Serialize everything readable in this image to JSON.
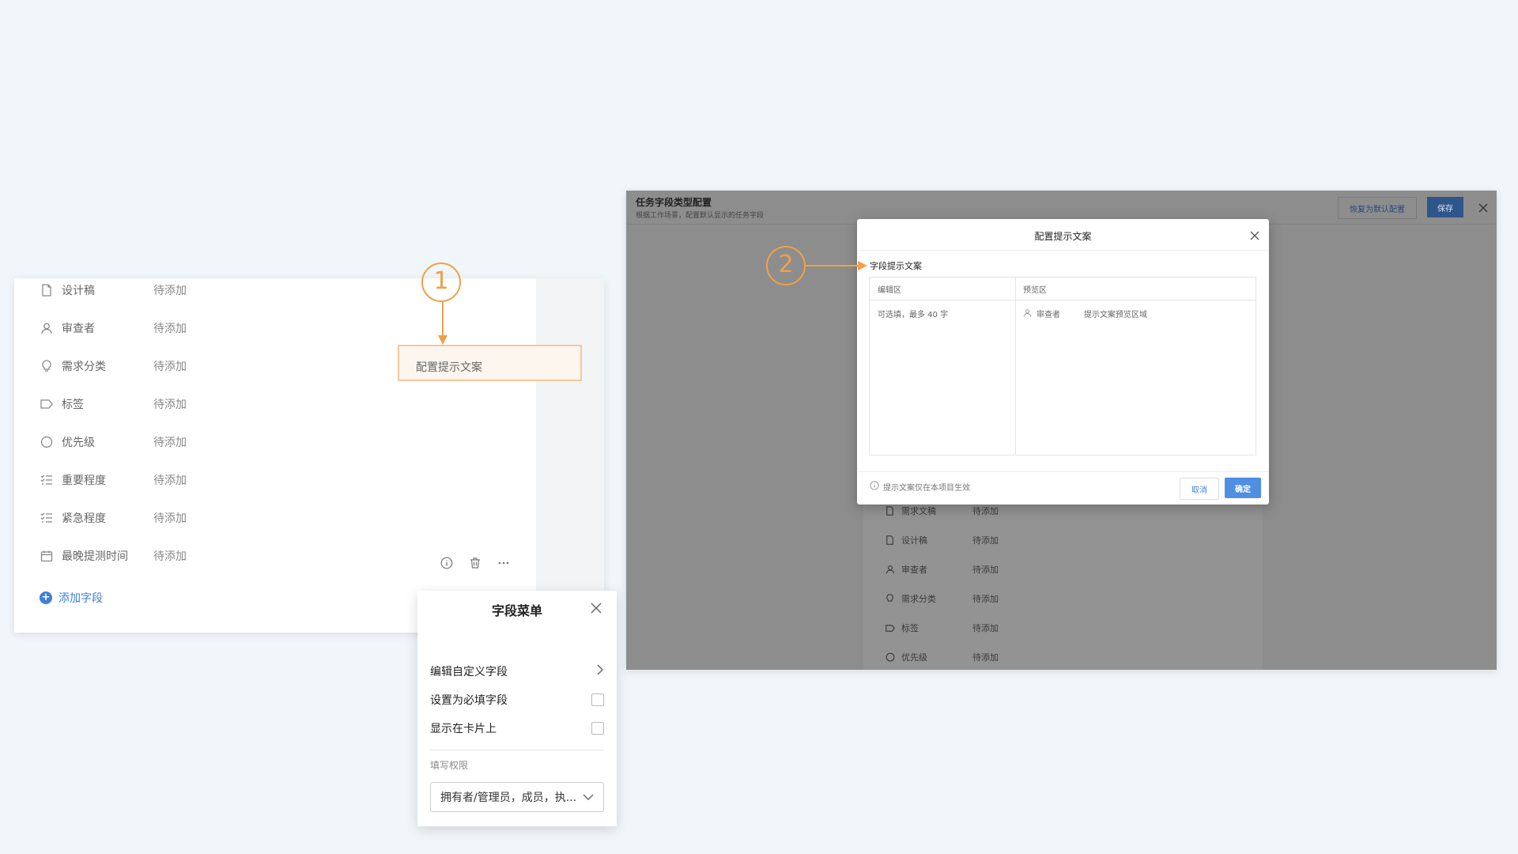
{
  "left": {
    "fields": [
      {
        "name": "设计稿",
        "status": "待添加",
        "icon": "file-icon"
      },
      {
        "name": "审查者",
        "status": "待添加",
        "icon": "user-icon"
      },
      {
        "name": "需求分类",
        "status": "待添加",
        "icon": "bulb-icon"
      },
      {
        "name": "标签",
        "status": "待添加",
        "icon": "tag-icon"
      },
      {
        "name": "优先级",
        "status": "待添加",
        "icon": "circle-icon"
      },
      {
        "name": "重要程度",
        "status": "待添加",
        "icon": "list-icon"
      },
      {
        "name": "紧急程度",
        "status": "待添加",
        "icon": "list-icon"
      },
      {
        "name": "最晚提测时间",
        "status": "待添加",
        "icon": "calendar-icon"
      }
    ],
    "add_field_label": "添加字段",
    "menu": {
      "title": "字段菜单",
      "config_hint": "配置提示文案",
      "edit_custom": "编辑自定义字段",
      "set_required": "设置为必填字段",
      "show_on_card": "显示在卡片上",
      "permission_label": "填写权限",
      "permission_value": "拥有者/管理员，成员，执..."
    }
  },
  "markers": {
    "one": "1",
    "two": "2"
  },
  "accent_color": "#f0a048",
  "right": {
    "title": "任务字段类型配置",
    "subtitle": "根据工作场景，配置默认显示的任务字段",
    "restore_label": "恢复为默认配置",
    "save_label": "保存",
    "background_rows": [
      {
        "name": "需求文稿",
        "status": "待添加",
        "icon": "file-icon"
      },
      {
        "name": "设计稿",
        "status": "待添加",
        "icon": "file-icon"
      },
      {
        "name": "审查者",
        "status": "待添加",
        "icon": "user-icon"
      },
      {
        "name": "需求分类",
        "status": "待添加",
        "icon": "bulb-icon"
      },
      {
        "name": "标签",
        "status": "待添加",
        "icon": "tag-icon"
      },
      {
        "name": "优先级",
        "status": "待添加",
        "icon": "circle-icon"
      }
    ],
    "dialog": {
      "title": "配置提示文案",
      "section_label": "字段提示文案",
      "col_edit": "编辑区",
      "col_preview": "预览区",
      "edit_placeholder": "可选填，最多 40 字",
      "preview_field": "审查者",
      "preview_text": "提示文案预览区域",
      "note": "提示文案仅在本项目生效",
      "cancel_label": "取消",
      "ok_label": "确定"
    }
  }
}
